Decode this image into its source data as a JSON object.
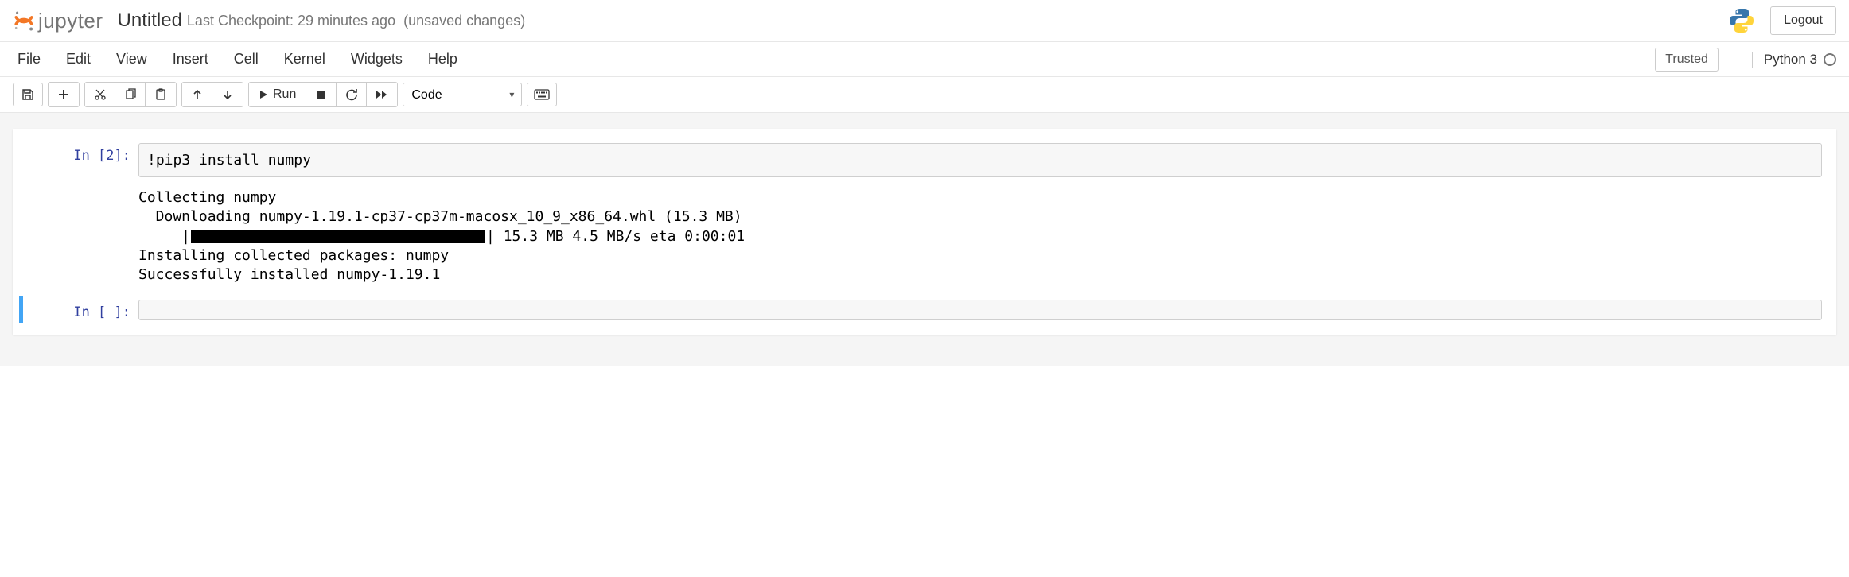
{
  "header": {
    "logo_text": "jupyter",
    "title": "Untitled",
    "checkpoint": "Last Checkpoint: 29 minutes ago",
    "unsaved": "(unsaved changes)",
    "logout": "Logout"
  },
  "menu": {
    "items": [
      "File",
      "Edit",
      "View",
      "Insert",
      "Cell",
      "Kernel",
      "Widgets",
      "Help"
    ],
    "trusted": "Trusted",
    "kernel": "Python 3"
  },
  "toolbar": {
    "run_label": "Run",
    "cell_type": "Code"
  },
  "cells": [
    {
      "prompt": "In [2]:",
      "input": "!pip3 install numpy",
      "output": {
        "line1": "Collecting numpy",
        "line2": "  Downloading numpy-1.19.1-cp37-cp37m-macosx_10_9_x86_64.whl (15.3 MB)",
        "progress_prefix": "     |",
        "progress_suffix": "| 15.3 MB 4.5 MB/s eta 0:00:01",
        "line4": "Installing collected packages: numpy",
        "line5": "Successfully installed numpy-1.19.1"
      }
    },
    {
      "prompt": "In [ ]:",
      "input": ""
    }
  ]
}
